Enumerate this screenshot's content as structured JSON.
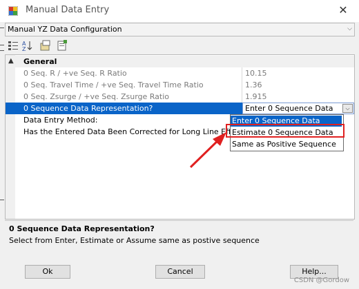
{
  "window": {
    "title": "Manual Data Entry",
    "close_glyph": "✕"
  },
  "config_combo": {
    "value": "Manual YZ Data Configuration",
    "arrow": "⌵"
  },
  "toolbar": {
    "icons": [
      "categorized-icon",
      "alphabetical-icon",
      "property-pages-icon",
      "events-icon"
    ]
  },
  "grid": {
    "category": {
      "label": "General",
      "toggle": "▲"
    },
    "rows": [
      {
        "name": "0 Seq. R / +ve Seq. R Ratio",
        "value": "10.15",
        "disabled": true
      },
      {
        "name": "0 Seq. Travel Time / +ve Seq. Travel Time Ratio",
        "value": "1.36",
        "disabled": true
      },
      {
        "name": "0 Seq. Zsurge / +ve Seq. Zsurge  Ratio",
        "value": "1.915",
        "disabled": true
      },
      {
        "name": "0 Sequence Data Representation?",
        "value": "Enter 0 Sequence Data",
        "selected": true
      },
      {
        "name": "Data Entry Method:",
        "value": ""
      },
      {
        "name": "Has the Entered Data Been Corrected for Long Line Effects?",
        "value": ""
      }
    ]
  },
  "dropdown": {
    "options": [
      "Enter 0 Sequence Data",
      "Estimate 0 Sequence Data",
      "Same as Positive Sequence"
    ],
    "highlighted_index": 0,
    "annotated_index": 1,
    "arrow_glyph": "⌵"
  },
  "description": {
    "title": "0 Sequence Data Representation?",
    "text": "Select from Enter, Estimate or Assume same as postive sequence"
  },
  "buttons": {
    "ok": "Ok",
    "cancel": "Cancel",
    "help": "Help..."
  },
  "watermark": "CSDN @Gordow",
  "colors": {
    "selection": "#0a64c8",
    "annotation": "#e02020"
  }
}
